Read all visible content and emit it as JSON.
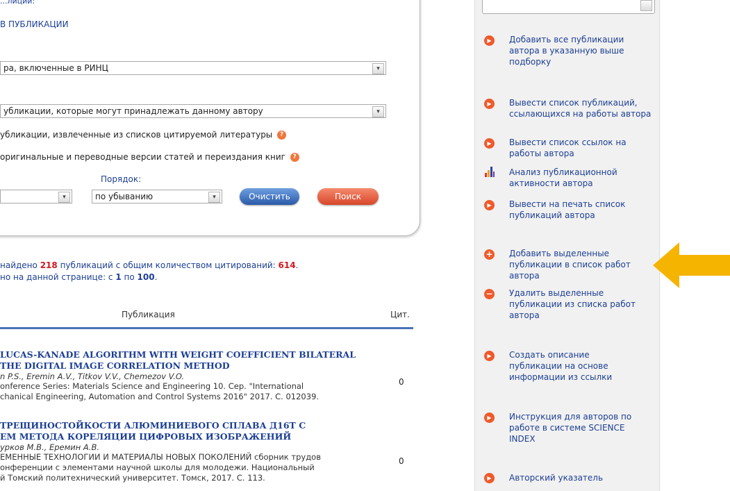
{
  "panel": {
    "partial_label": "...лиции:",
    "in_publications": "в публикации",
    "filter_select": "ра, включенные в РИНЦ",
    "publications_select": "убликации, которые могут принадлежать данному автору",
    "check_citations": "убликации, извлеченные из списков цитируемой литературы",
    "check_versions": "оригинальные и переводные версии статей и переиздания книг",
    "order_label": "Порядок:",
    "order_value": "по убыванию",
    "clear_button": "Очистить",
    "search_button": "Поиск"
  },
  "summary": {
    "line1_pre": "найдено ",
    "found_count": "218",
    "line1_mid": " публикаций с общим количеством цитирований: ",
    "citations_total": "614",
    "line1_end": ".",
    "line2_pre": "но на данной странице: с ",
    "from": "1",
    "line2_mid": " по ",
    "to": "100",
    "line2_end": "."
  },
  "table": {
    "col_publication": "Публикация",
    "col_cited": "Цит."
  },
  "publications": [
    {
      "title1": "LUCAS-KANADE ALGORITHM WITH WEIGHT COEFFICIENT BILATERAL",
      "title2": "THE DIGITAL IMAGE CORRELATION METHOD",
      "authors": "n P.S., Eremin A.V., Titkov V.V., Chemezov V.O.",
      "src1": "onference Series: Materials Science and Engineering 10. Сер. \"International",
      "src2": "chanical Engineering, Automation and Control Systems 2016\" 2017. С. 012039.",
      "cited": "0"
    },
    {
      "title1": "ТРЕЩИНОСТОЙКОСТИ АЛЮМИНИЕВОГО СПЛАВА Д16Т С",
      "title2": "ЕМ МЕТОДА КОРЕЛЯЦИИ ЦИФРОВЫХ ИЗОБРАЖЕНИЙ",
      "authors": "урков М.В., Еремин А.В.",
      "src1": "ЕМЕННЫЕ ТЕХНОЛОГИИ И МАТЕРИАЛЫ НОВЫХ ПОКОЛЕНИЙ сборник трудов",
      "src2": "онференции с элементами научной школы для молодежи. Национальный",
      "src3": "й Томский политехнический университет. Томск, 2017. С. 113.",
      "cited": "0"
    }
  ],
  "sidebar": {
    "items": [
      {
        "icon": "play-circle-icon",
        "text": "Добавить все публикации автора в указанную выше подборку"
      },
      {
        "icon": "play-circle-icon",
        "text": "Вывести список публикаций, ссылающихся на работы автора"
      },
      {
        "icon": "play-circle-icon",
        "text": "Вывести список ссылок на работы автора"
      },
      {
        "icon": "bar-chart-icon",
        "text": "Анализ публикационной активности автора"
      },
      {
        "icon": "play-circle-icon",
        "text": "Вывести на печать список публикаций автора"
      },
      {
        "icon": "plus-circle-icon",
        "text": "Добавить выделенные публикации в список работ автора"
      },
      {
        "icon": "minus-circle-icon",
        "text": "Удалить выделенные публикации из списка работ автора"
      },
      {
        "icon": "play-circle-icon",
        "text": "Создать описание публикации на основе информации из ссылки"
      },
      {
        "icon": "play-circle-icon",
        "text": "Инструкция для авторов по работе в системе SCIENCE INDEX"
      },
      {
        "icon": "play-circle-icon",
        "text": "Авторский указатель"
      }
    ]
  },
  "colors": {
    "link": "#1c3f94",
    "accent_red": "#d4171e",
    "arrow": "#f5b400"
  }
}
